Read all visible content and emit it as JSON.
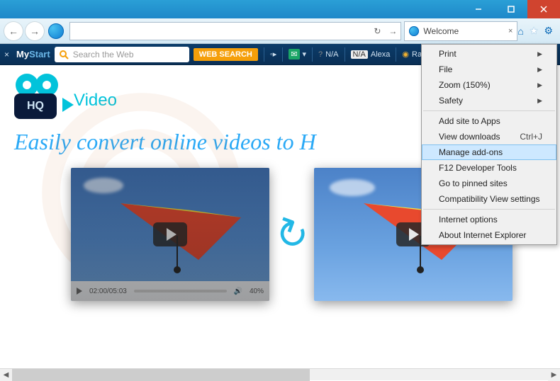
{
  "window": {
    "minimize": "–",
    "maximize": "□",
    "close": "×"
  },
  "nav": {
    "back": "←",
    "forward": "→"
  },
  "address": {
    "placeholder": "",
    "refresh": "↻",
    "stop": "→"
  },
  "tab": {
    "title": "Welcome"
  },
  "chrome_icons": {
    "home": "⌂",
    "fav": "★",
    "tools": "⚙"
  },
  "mystart": {
    "close": "×",
    "logo_part1": "My",
    "logo_part2": "Start",
    "search_placeholder": "Search the Web",
    "web_search_btn": "WEB SEARCH",
    "speed_dn": "◦▸",
    "mail_na": "N/A",
    "rank_na": "N/A",
    "alexa": "Alexa",
    "radio": "Radio"
  },
  "page": {
    "hq_text": "HQ",
    "brand_word": "Video",
    "tagline": "Easily convert online videos to H",
    "player_time": "02:00/05:03",
    "vol_pct": "40%"
  },
  "menu": {
    "print": "Print",
    "file": "File",
    "zoom": "Zoom (150%)",
    "safety": "Safety",
    "add_site": "Add site to Apps",
    "view_dl": "View downloads",
    "view_dl_sc": "Ctrl+J",
    "manage": "Manage add-ons",
    "f12": "F12 Developer Tools",
    "pinned": "Go to pinned sites",
    "compat": "Compatibility View settings",
    "inet": "Internet options",
    "about": "About Internet Explorer"
  }
}
